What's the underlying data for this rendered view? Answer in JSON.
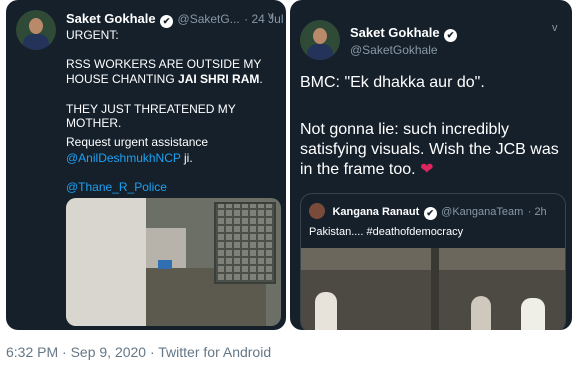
{
  "left_tweet": {
    "author_name": "Saket Gokhale",
    "author_handle": "@SaketG...",
    "time": "· 24 Jul",
    "chevron": "v",
    "verified_glyph": "✔",
    "lines": {
      "urgent": "URGENT:",
      "line1_start": "RSS WORKERS ARE OUTSIDE MY HOUSE CHANTING ",
      "line1_bold": "JAI SHRI RAM",
      "line1_end": ".",
      "line2": "THEY JUST THREATENED MY MOTHER.",
      "line3_start": "Request urgent assistance",
      "line3_mention": "@AnilDeshmukhNCP",
      "line3_end": " ji.",
      "line4_mention": "@Thane_R_Police"
    }
  },
  "right_tweet": {
    "author_name": "Saket Gokhale",
    "author_handle": "@SaketGokhale",
    "verified_glyph": "✔",
    "chevron": "v",
    "line1": "BMC: \"Ek dhakka aur do\".",
    "line2": "Not gonna lie: such incredibly satisfying visuals. Wish the JCB was in the frame too.",
    "heart": "❤"
  },
  "quoted_tweet": {
    "author_name": "Kangana Ranaut",
    "author_handle": "@KanganaTeam",
    "time": "· 2h",
    "verified_glyph": "✔",
    "text": "Pakistan.... #deathofdemocracy"
  },
  "footer": {
    "timestamp": "6:32 PM · Sep 9, 2020 · Twitter for Android"
  },
  "colors": {
    "background": "#15202b",
    "link": "#1da1f2",
    "secondary_text": "#8899a6"
  }
}
